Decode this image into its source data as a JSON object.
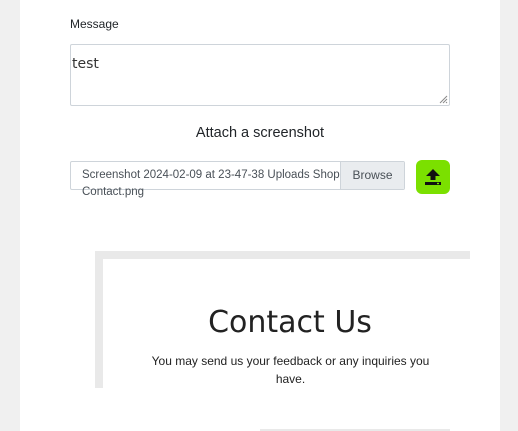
{
  "form": {
    "message_label": "Message",
    "message_value": "test",
    "attach_title": "Attach a screenshot",
    "file_name_line1": "Screenshot 2024-02-09 at 23-47-38 Uploads Shop",
    "file_name_line2": "Contact.png",
    "browse_label": "Browse",
    "upload_icon": "upload-icon",
    "upload_color": "#7be000"
  },
  "preview": {
    "title": "Contact Us",
    "subtitle": "You may send us your feedback or any inquiries you have."
  }
}
